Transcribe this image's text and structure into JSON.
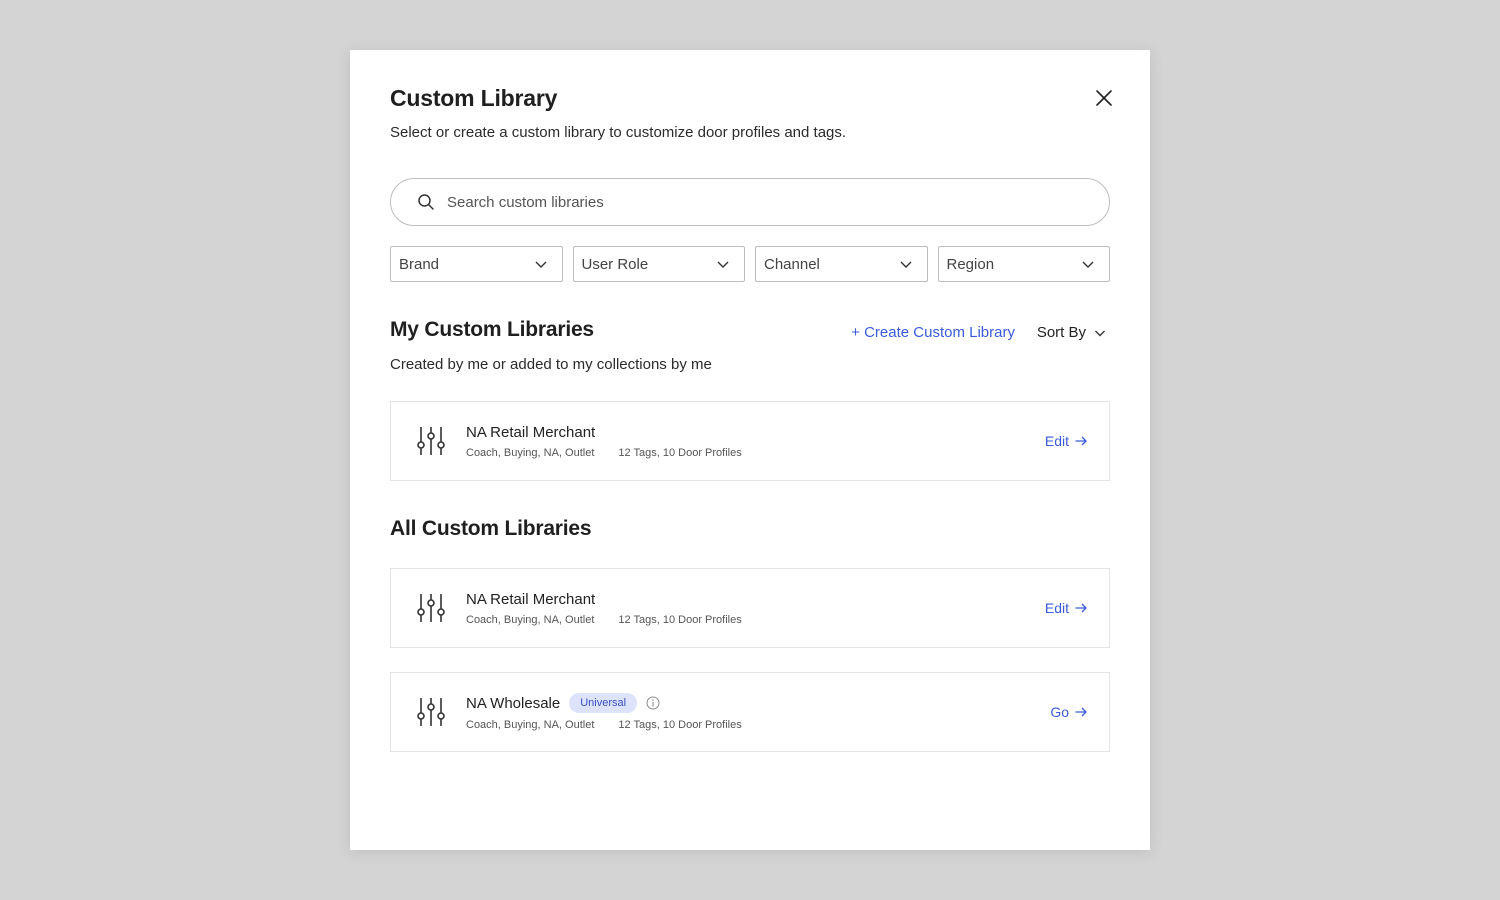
{
  "modal": {
    "title": "Custom Library",
    "subtitle": "Select or create a custom library to customize door profiles and tags."
  },
  "search": {
    "placeholder": "Search custom libraries"
  },
  "filters": [
    {
      "label": "Brand"
    },
    {
      "label": "User Role"
    },
    {
      "label": "Channel"
    },
    {
      "label": "Region"
    }
  ],
  "my_libraries": {
    "title": "My Custom Libraries",
    "subtitle": "Created by me or added to my collections by me",
    "create_label": "+ Create Custom Library",
    "sort_label": "Sort By",
    "items": [
      {
        "name": "NA Retail Merchant",
        "tags_text": "Coach, Buying, NA, Outlet",
        "counts_text": "12 Tags, 10 Door Profiles",
        "action": "Edit"
      }
    ]
  },
  "all_libraries": {
    "title": "All Custom Libraries",
    "items": [
      {
        "name": "NA Retail Merchant",
        "tags_text": "Coach, Buying, NA, Outlet",
        "counts_text": "12 Tags, 10 Door Profiles",
        "action": "Edit"
      },
      {
        "name": "NA Wholesale",
        "badge": "Universal",
        "tags_text": "Coach, Buying, NA, Outlet",
        "counts_text": "12 Tags, 10 Door Profiles",
        "action": "Go"
      }
    ]
  },
  "colors": {
    "accent": "#3b5bdb",
    "badge_bg": "#dde3fa",
    "backdrop": "#d4d4d4"
  },
  "icons": {
    "close": "close-icon",
    "search": "search-icon",
    "dropdown": "chevron-down-icon",
    "library": "sliders-icon",
    "arrow": "arrow-right-icon",
    "info": "info-icon"
  }
}
